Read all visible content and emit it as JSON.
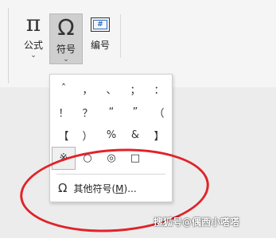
{
  "ribbon": {
    "formula": {
      "icon": "π",
      "label": "公式",
      "dropdown": "⌄"
    },
    "symbol": {
      "icon": "Ω",
      "label": "符号",
      "dropdown": "⌄"
    },
    "number": {
      "icon": "#",
      "label": "编号"
    }
  },
  "symbol_menu": {
    "symbols": [
      "ˆ",
      "，",
      "、",
      "；",
      "：",
      "！",
      "？",
      "“",
      "”",
      "（",
      "【",
      "）",
      "%",
      "&",
      "】",
      "※",
      "○",
      "◎",
      "□",
      ""
    ],
    "selected_symbol": "※",
    "more_icon": "Ω",
    "more_label_prefix": "其他符号(",
    "more_label_accel": "M",
    "more_label_suffix": ")..."
  },
  "watermark": "搜狐号@偶西小嗒嗒",
  "colors": {
    "annotation_circle": "#e0232a",
    "selected_button": "#cfcfcf"
  }
}
